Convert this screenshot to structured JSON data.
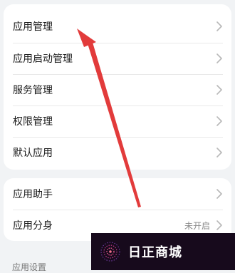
{
  "groups": [
    {
      "items": [
        {
          "label": "应用管理"
        },
        {
          "label": "应用启动管理"
        },
        {
          "label": "服务管理"
        },
        {
          "label": "权限管理"
        },
        {
          "label": "默认应用"
        }
      ]
    },
    {
      "items": [
        {
          "label": "应用助手",
          "value": ""
        },
        {
          "label": "应用分身",
          "value": "未开启"
        }
      ]
    }
  ],
  "section_title": "应用设置",
  "watermark": {
    "text": "日正商城"
  },
  "colors": {
    "background": "#f1f3f5",
    "card": "#ffffff",
    "annotation_arrow": "#e23b3b",
    "watermark_bg": "#170a1c"
  },
  "icons": {
    "row_chevron": "chevron-right-icon",
    "watermark_logo": "dotted-globe-logo-icon"
  }
}
